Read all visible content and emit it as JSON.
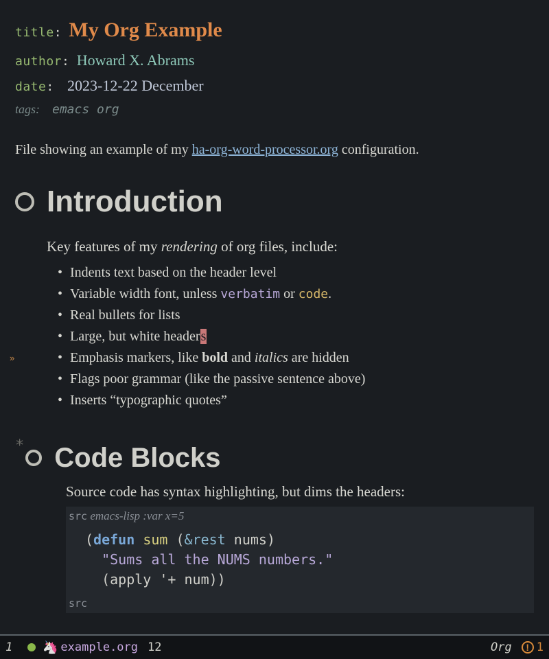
{
  "meta": {
    "title_key": "title",
    "title_value": "My Org Example",
    "author_key": "author",
    "author_value": "Howard X. Abrams",
    "date_key": "date",
    "date_value": "2023-12-22 December",
    "tags_key": "tags:",
    "tags_value": "emacs org"
  },
  "intro": {
    "file_text_before": "File showing an example of my ",
    "link_text": "ha-org-word-processor.org",
    "file_text_after": " configuration.",
    "heading": "Introduction",
    "para_before": "Key features of my ",
    "para_ital": "rendering",
    "para_after": " of org files, include:",
    "items": {
      "i0": "Indents text based on the header level",
      "i1_a": "Variable width font, unless ",
      "i1_verbatim": "verbatim",
      "i1_b": " or ",
      "i1_code": "code",
      "i1_c": ".",
      "i2": "Real bullets for lists",
      "i3_a": "Large, but white header",
      "i3_warn": "s",
      "i4_a": "Emphasis markers, like ",
      "i4_bold": "bold",
      "i4_b": " and ",
      "i4_ital": "italics",
      "i4_c": " are hidden",
      "i5": "Flags poor grammar (like the passive sentence above)",
      "i6": "Inserts “typographic quotes”"
    }
  },
  "code": {
    "heading": "Code Blocks",
    "star": "*",
    "para": "Source code has syntax highlighting, but dims the headers:",
    "src_begin_kw": "src",
    "src_begin_rest": " emacs-lisp :var x=5",
    "src_end": "src",
    "line1_open": "(",
    "line1_defun": "defun",
    "line1_sp1": " ",
    "line1_fn": "sum",
    "line1_sp2": " (",
    "line1_amp": "&rest",
    "line1_sp3": " ",
    "line1_arg": "nums",
    "line1_close": ")",
    "line2": "\"Sums all the NUMS numbers.\"",
    "line3_a": "(apply '+ num))"
  },
  "modeline": {
    "win": "1",
    "buffer": "example.org",
    "line": "12",
    "mode": "Org",
    "err_glyph": "!",
    "err_count": "1"
  }
}
